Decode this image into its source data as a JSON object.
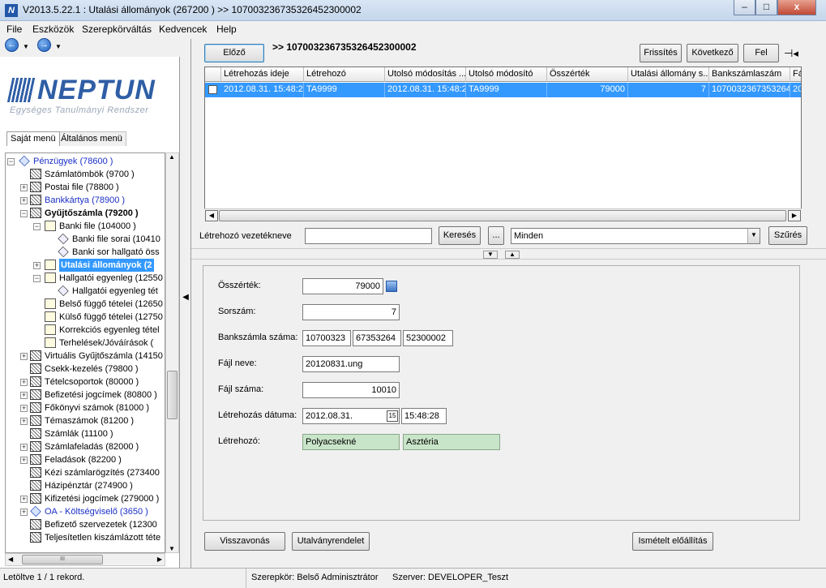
{
  "window": {
    "title": "V2013.5.22.1 : Utalási állományok (267200  )  >> 10700323673532645230000​2",
    "minimize": "–",
    "maximize": "□",
    "close": "x"
  },
  "menu": [
    "File",
    "Eszközök",
    "Szerepkörváltás",
    "Kedvencek",
    "Help"
  ],
  "logo": {
    "name": "NEPTUN",
    "subtitle": "Egységes Tanulmányi Rendszer"
  },
  "left_tabs": [
    "Saját menü",
    "Általános menü"
  ],
  "tree": [
    {
      "label": "Pénzügyek (78600  )"
    },
    {
      "label": "Számlatömbök (9700  )"
    },
    {
      "label": "Postai file (78800  )"
    },
    {
      "label": "Bankkártya (78900  )"
    },
    {
      "label": "Gyűjtőszámla (79200  )"
    },
    {
      "label": "Banki file (104000  )"
    },
    {
      "label": "Banki file sorai (10410"
    },
    {
      "label": "Banki sor hallgató öss"
    },
    {
      "label": "Utalási állományok (2"
    },
    {
      "label": "Hallgatói egyenleg (12550"
    },
    {
      "label": "Hallgatói egyenleg tét"
    },
    {
      "label": "Belső függő tételei (12650"
    },
    {
      "label": "Külső függő tételei (12750"
    },
    {
      "label": "Korrekciós egyenleg tétel"
    },
    {
      "label": "Terhelések/Jóváírások ("
    },
    {
      "label": "Virtuális Gyűjtőszámla (14150"
    },
    {
      "label": "Csekk-kezelés (79800  )"
    },
    {
      "label": "Tételcsoportok (80000  )"
    },
    {
      "label": "Befizetési jogcímek (80800  )"
    },
    {
      "label": "Főkönyvi számok (81000  )"
    },
    {
      "label": "Témaszámok (81200  )"
    },
    {
      "label": "Számlák (11100  )"
    },
    {
      "label": "Számlafeladás (82000  )"
    },
    {
      "label": "Feladások (82200  )"
    },
    {
      "label": "Kézi számlarögzítés (273400"
    },
    {
      "label": "Házipénztár (274900  )"
    },
    {
      "label": "Kifizetési jogcímek (279000  )"
    },
    {
      "label": "OA - Költségviselő (3650  )"
    },
    {
      "label": "Befizető szervezetek (12300"
    },
    {
      "label": "Teljesítetlen kiszámlázott téte"
    }
  ],
  "hscroll_grip": "III",
  "toolbar": {
    "prev": "Előző",
    "record_id": ">> 107003236735326452300002",
    "refresh": "Frissítés",
    "next": "Következő",
    "up": "Fel",
    "pin": "⊣◂"
  },
  "grid": {
    "headers": [
      "Létrehozás ideje",
      "Létrehozó",
      "Utolsó módosítás ...",
      "Utolsó módosító",
      "Összérték",
      "Utalási állomány s...",
      "Bankszámlaszám",
      "Fá"
    ],
    "row": [
      "2012.08.31. 15:48:2",
      "TA9999",
      "2012.08.31. 15:48:2",
      "TA9999",
      "79000",
      "7",
      "10700323673532645",
      "20"
    ]
  },
  "filter": {
    "label": "Létrehozó vezetékneve",
    "value": "",
    "search": "Keresés",
    "dots": "...",
    "select": "Minden",
    "filter_btn": "Szűrés"
  },
  "detail": {
    "osszertek_label": "Összérték:",
    "osszertek": "79000",
    "sorszam_label": "Sorszám:",
    "sorszam": "7",
    "bankszamla_label": "Bankszámla száma:",
    "bank1": "10700323",
    "bank2": "67353264",
    "bank3": "52300002",
    "fajlnev_label": "Fájl neve:",
    "fajlnev": "20120831.ung",
    "fajlszam_label": "Fájl száma:",
    "fajlszam": "10010",
    "datum_label": "Létrehozás dátuma:",
    "datum": "2012.08.31.",
    "date_icon": "15",
    "ido": "15:48:28",
    "letrehozo_label": "Létrehozó:",
    "vezeteknev": "Polyacsekné",
    "keresztnev": "Asztéria"
  },
  "bottom": {
    "visszavonas": "Visszavonás",
    "utalvany": "Utalványrendelet",
    "ismetelt": "Ismételt előállítás"
  },
  "status": {
    "loaded": "Letöltve 1 / 1 rekord.",
    "role": "Szerepkör: Belső Adminisztrátor",
    "server": "Szerver: DEVELOPER_Teszt"
  }
}
